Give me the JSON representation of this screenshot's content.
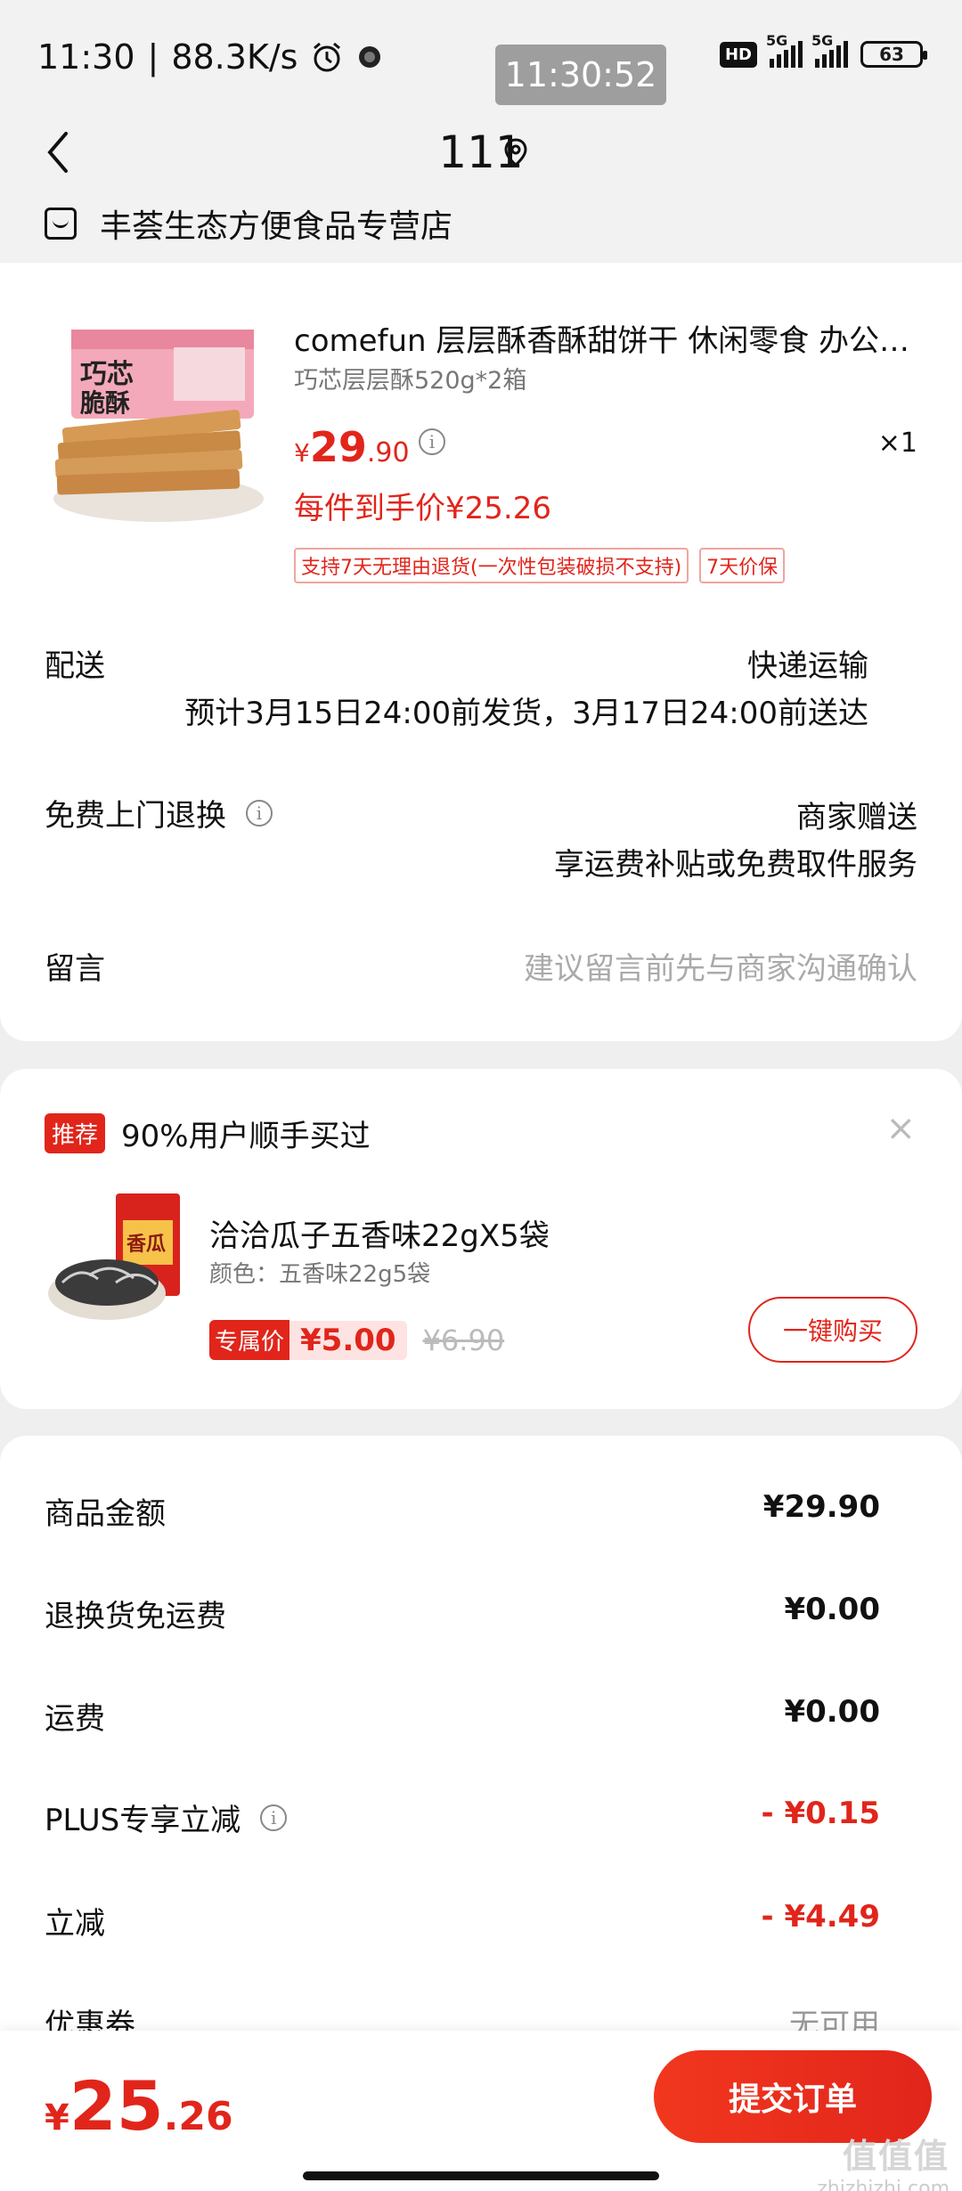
{
  "status_bar": {
    "time": "11:30",
    "speed": "88.3K/s",
    "clock_overlay": "11:30:52",
    "hd": "HD",
    "network_1": "5G",
    "network_2": "5G",
    "battery": "63"
  },
  "header": {
    "title": "111"
  },
  "store": {
    "name": "丰荟生态方便食品专营店"
  },
  "product": {
    "title": "comefun 层层酥香酥甜饼干 休闲零食 办公室下午茶早餐代餐",
    "spec": "巧芯层层酥520g*2箱",
    "price_currency": "¥",
    "price_int": "29",
    "price_dec": ".90",
    "quantity": "×1",
    "net_price": "每件到手价¥25.26",
    "tags": [
      "支持7天无理由退货(一次性包装破损不支持)",
      "7天价保"
    ]
  },
  "delivery": {
    "label": "配送",
    "method": "快递运输",
    "estimate": "预计3月15日24:00前发货，3月17日24:00前送达"
  },
  "return_service": {
    "label": "免费上门退换",
    "value": "商家赠送",
    "detail": "享运费补贴或免费取件服务"
  },
  "message": {
    "label": "留言",
    "placeholder": "建议留言前先与商家沟通确认"
  },
  "recommend": {
    "badge": "推荐",
    "title": "90%用户顺手买过",
    "close": "×",
    "item_name": "洽洽瓜子五香味22gX5袋",
    "item_spec": "颜色：五香味22g5袋",
    "exclusive_label": "专属价",
    "price": "¥5.00",
    "original_price": "¥6.90",
    "buy_label": "一键购买"
  },
  "summary": {
    "rows": [
      {
        "label": "商品金额",
        "value": "¥29.90"
      },
      {
        "label": "退换货免运费",
        "value": "¥0.00"
      },
      {
        "label": "运费",
        "value": "¥0.00"
      },
      {
        "label": "PLUS专享立减",
        "value": "- ¥0.15"
      },
      {
        "label": "立减",
        "value": "- ¥4.49"
      },
      {
        "label": "优惠券",
        "value": "无可用"
      }
    ]
  },
  "bottom": {
    "total_currency": "¥",
    "total_int": "25",
    "total_dec": ".26",
    "submit_label": "提交订单"
  },
  "watermark": {
    "mark": "值值值",
    "site": "zhizhizhi.com"
  },
  "colors": {
    "accent": "#e1251b",
    "background": "#efefef"
  }
}
